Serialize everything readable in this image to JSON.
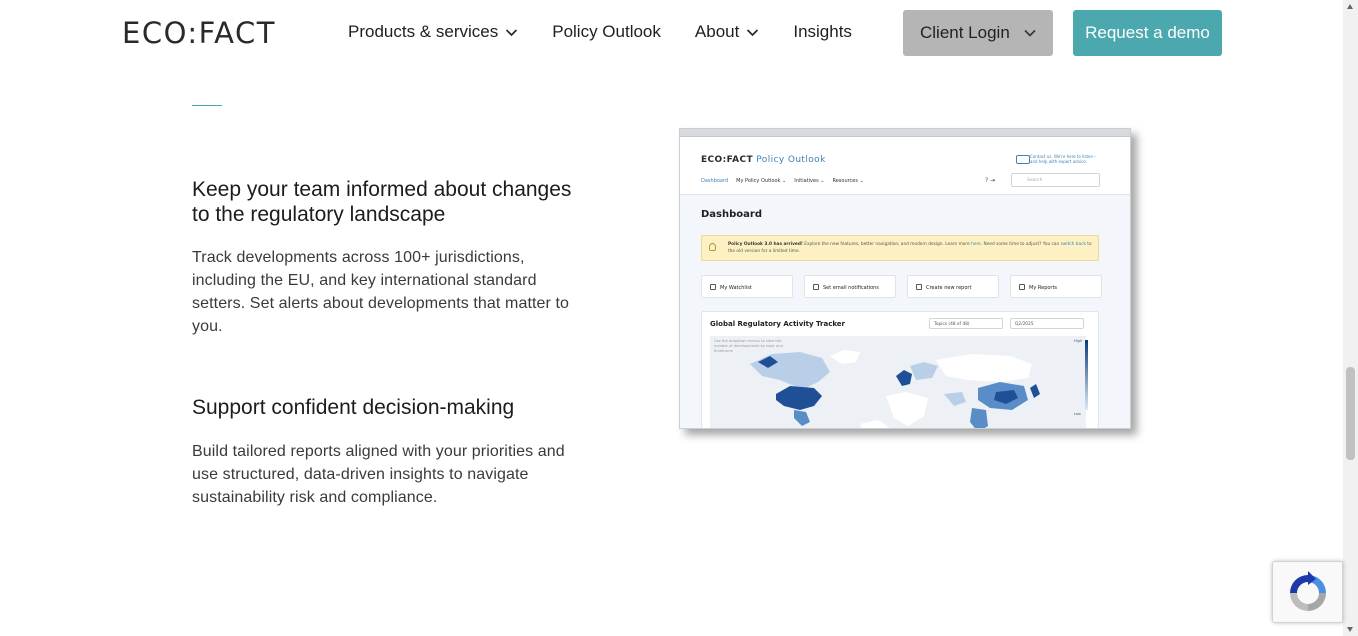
{
  "header": {
    "logo": "ECO:FACT",
    "nav": [
      {
        "label": "Products & services",
        "has_dropdown": true
      },
      {
        "label": "Policy Outlook",
        "has_dropdown": false
      },
      {
        "label": "About",
        "has_dropdown": true
      },
      {
        "label": "Insights",
        "has_dropdown": false
      }
    ],
    "client_login": "Client Login",
    "request_demo": "Request a demo"
  },
  "features": [
    {
      "title": "Keep your team informed about changes to the regulatory landscape",
      "body": "Track developments across 100+ jurisdictions, including the EU, and key international standard setters. Set alerts about developments that matter to you."
    },
    {
      "title": "Support confident decision-making",
      "body": "Build tailored reports aligned with your priorities and use structured, data-driven insights to navigate sustainability risk and compliance."
    }
  ],
  "mockup": {
    "logo_main": "ECO:FACT",
    "logo_product": "Policy Outlook",
    "contact": "Contact us. We're here to listen – and help with expert advice.",
    "nav": [
      "Dashboard",
      "My Policy Outlook ⌄",
      "Initiatives ⌄",
      "Resources ⌄"
    ],
    "header_icons": "?  ⇥",
    "search_placeholder": "Search",
    "page_title": "Dashboard",
    "banner_bold": "Policy Outlook 3.0 has arrived!",
    "banner_text": " Explore the new features, better navigation, and modern design. Learn more ",
    "banner_link1": "here",
    "banner_text2": ". Need some time to adjust? You can ",
    "banner_link2": "switch back",
    "banner_text3": " to the old version for a limited time.",
    "cards": [
      "My Watchlist",
      "Set email notifications",
      "Create new report",
      "My Reports"
    ],
    "tracker_title": "Global Regulatory Activity Tracker",
    "topics_select": "Topics (48 of 48)",
    "period_select": "Q2/2025",
    "tracker_help": "Use the dropdown menus to view the number of developments by topic and timeframe",
    "legend_high": "High",
    "legend_low": "Low"
  },
  "colors": {
    "accent": "#4aa8ae",
    "client_login_bg": "#b5b5b5",
    "map_dark": "#1f4f96",
    "map_mid": "#5a8dc8",
    "map_light": "#b9cfe8"
  }
}
